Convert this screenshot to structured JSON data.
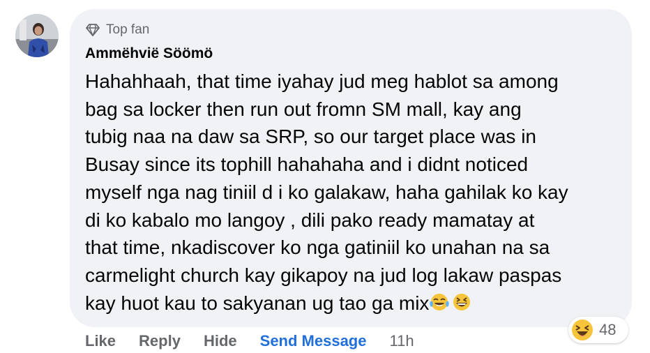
{
  "comment": {
    "badge": "Top fan",
    "author": "Ammëhvië Söömö",
    "text_lines": [
      "Hahahhaah, that time iyahay jud meg hablot sa among",
      "bag sa locker then run out fromn SM mall, kay ang",
      "tubig naa na daw sa SRP, so our target place was in",
      "Busay since its tophill hahahaha and i didnt noticed",
      "myself nga nag tiniil d i ko galakaw, haha gahilak ko kay",
      "di ko kabalo mo langoy , dili pako ready mamatay at",
      "that time, nkadiscover ko nga gatiniil ko unahan na sa",
      "carmelight church kay gikapoy na jud log lakaw paspas",
      "kay huot kau to sakyanan ug tao ga mix"
    ],
    "trailing_emoji": [
      "face-with-tears-of-joy",
      "grinning-squinting-face"
    ],
    "reaction_icon": "laughing-emoji-icon",
    "reaction_count": "48"
  },
  "actions": {
    "like": "Like",
    "reply": "Reply",
    "hide": "Hide",
    "send_message": "Send Message",
    "time": "11h"
  },
  "colors": {
    "bubble": "#f0f2f5",
    "text": "#050505",
    "muted": "#65676b",
    "link": "#216fdb"
  }
}
